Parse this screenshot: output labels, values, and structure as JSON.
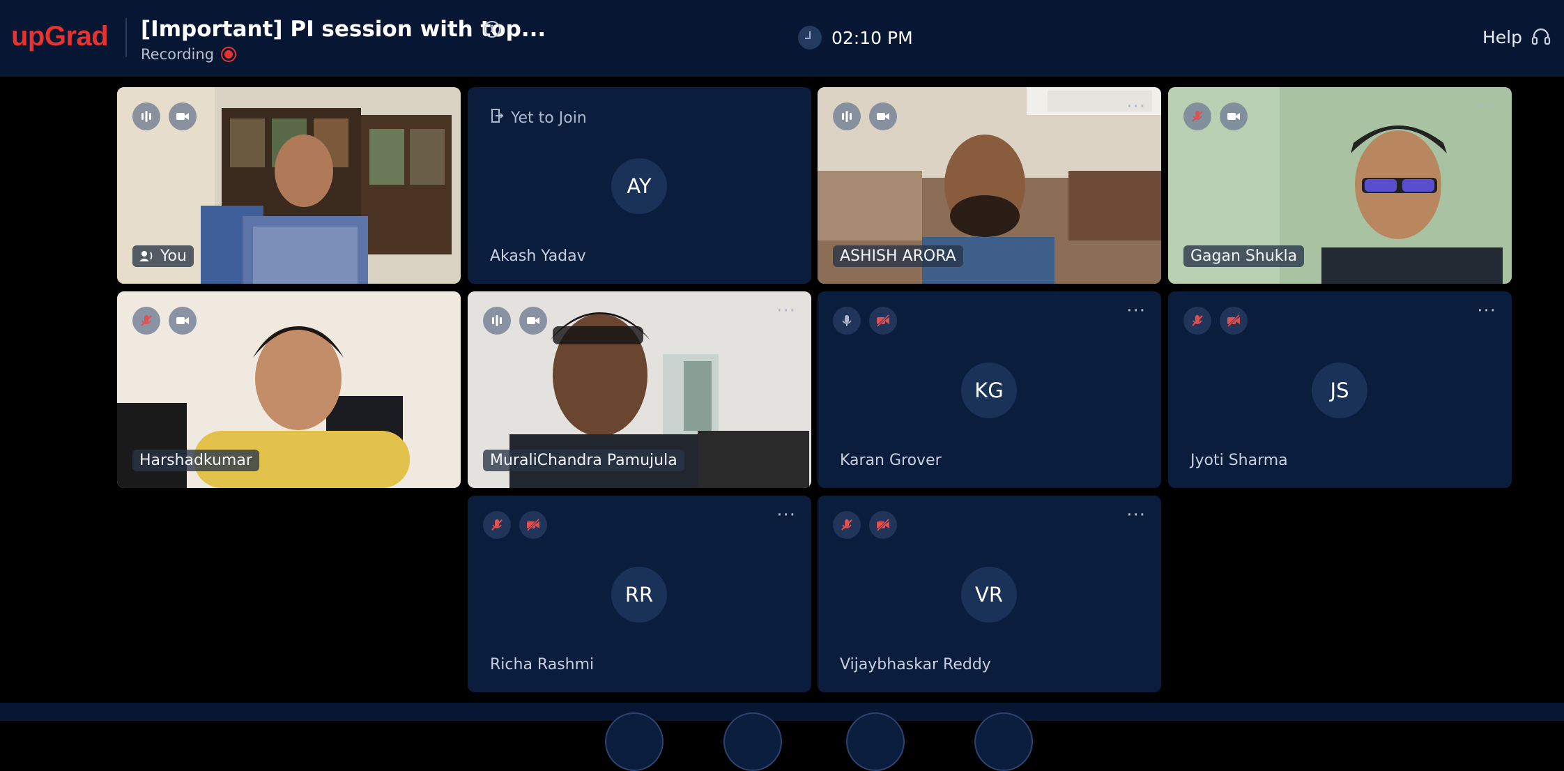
{
  "header": {
    "logo": "upGrad",
    "title": "[Important] PI session with top...",
    "recording_label": "Recording",
    "time": "02:10 PM",
    "help_label": "Help"
  },
  "colors": {
    "brand": "#e8322f",
    "header_bg": "#061633",
    "tile_bg": "#0b1d3d"
  },
  "participants": [
    {
      "name": "You",
      "initials": "",
      "status": "",
      "mic": "active",
      "camera": "on"
    },
    {
      "name": "Akash Yadav",
      "initials": "AY",
      "status": "Yet to Join",
      "mic": "",
      "camera": ""
    },
    {
      "name": "ASHISH ARORA",
      "initials": "",
      "status": "",
      "mic": "active",
      "camera": "on"
    },
    {
      "name": "Gagan Shukla",
      "initials": "",
      "status": "",
      "mic": "muted",
      "camera": "on"
    },
    {
      "name": "Harshadkumar",
      "initials": "",
      "status": "",
      "mic": "muted",
      "camera": "on"
    },
    {
      "name": "MuraliChandra Pamujula",
      "initials": "",
      "status": "",
      "mic": "active",
      "camera": "on"
    },
    {
      "name": "Karan Grover",
      "initials": "KG",
      "status": "",
      "mic": "on",
      "camera": "off"
    },
    {
      "name": "Jyoti Sharma",
      "initials": "JS",
      "status": "",
      "mic": "muted",
      "camera": "off"
    },
    {
      "name": "Richa Rashmi",
      "initials": "RR",
      "status": "",
      "mic": "muted",
      "camera": "off"
    },
    {
      "name": "Vijaybhaskar Reddy",
      "initials": "VR",
      "status": "",
      "mic": "muted",
      "camera": "off"
    }
  ]
}
